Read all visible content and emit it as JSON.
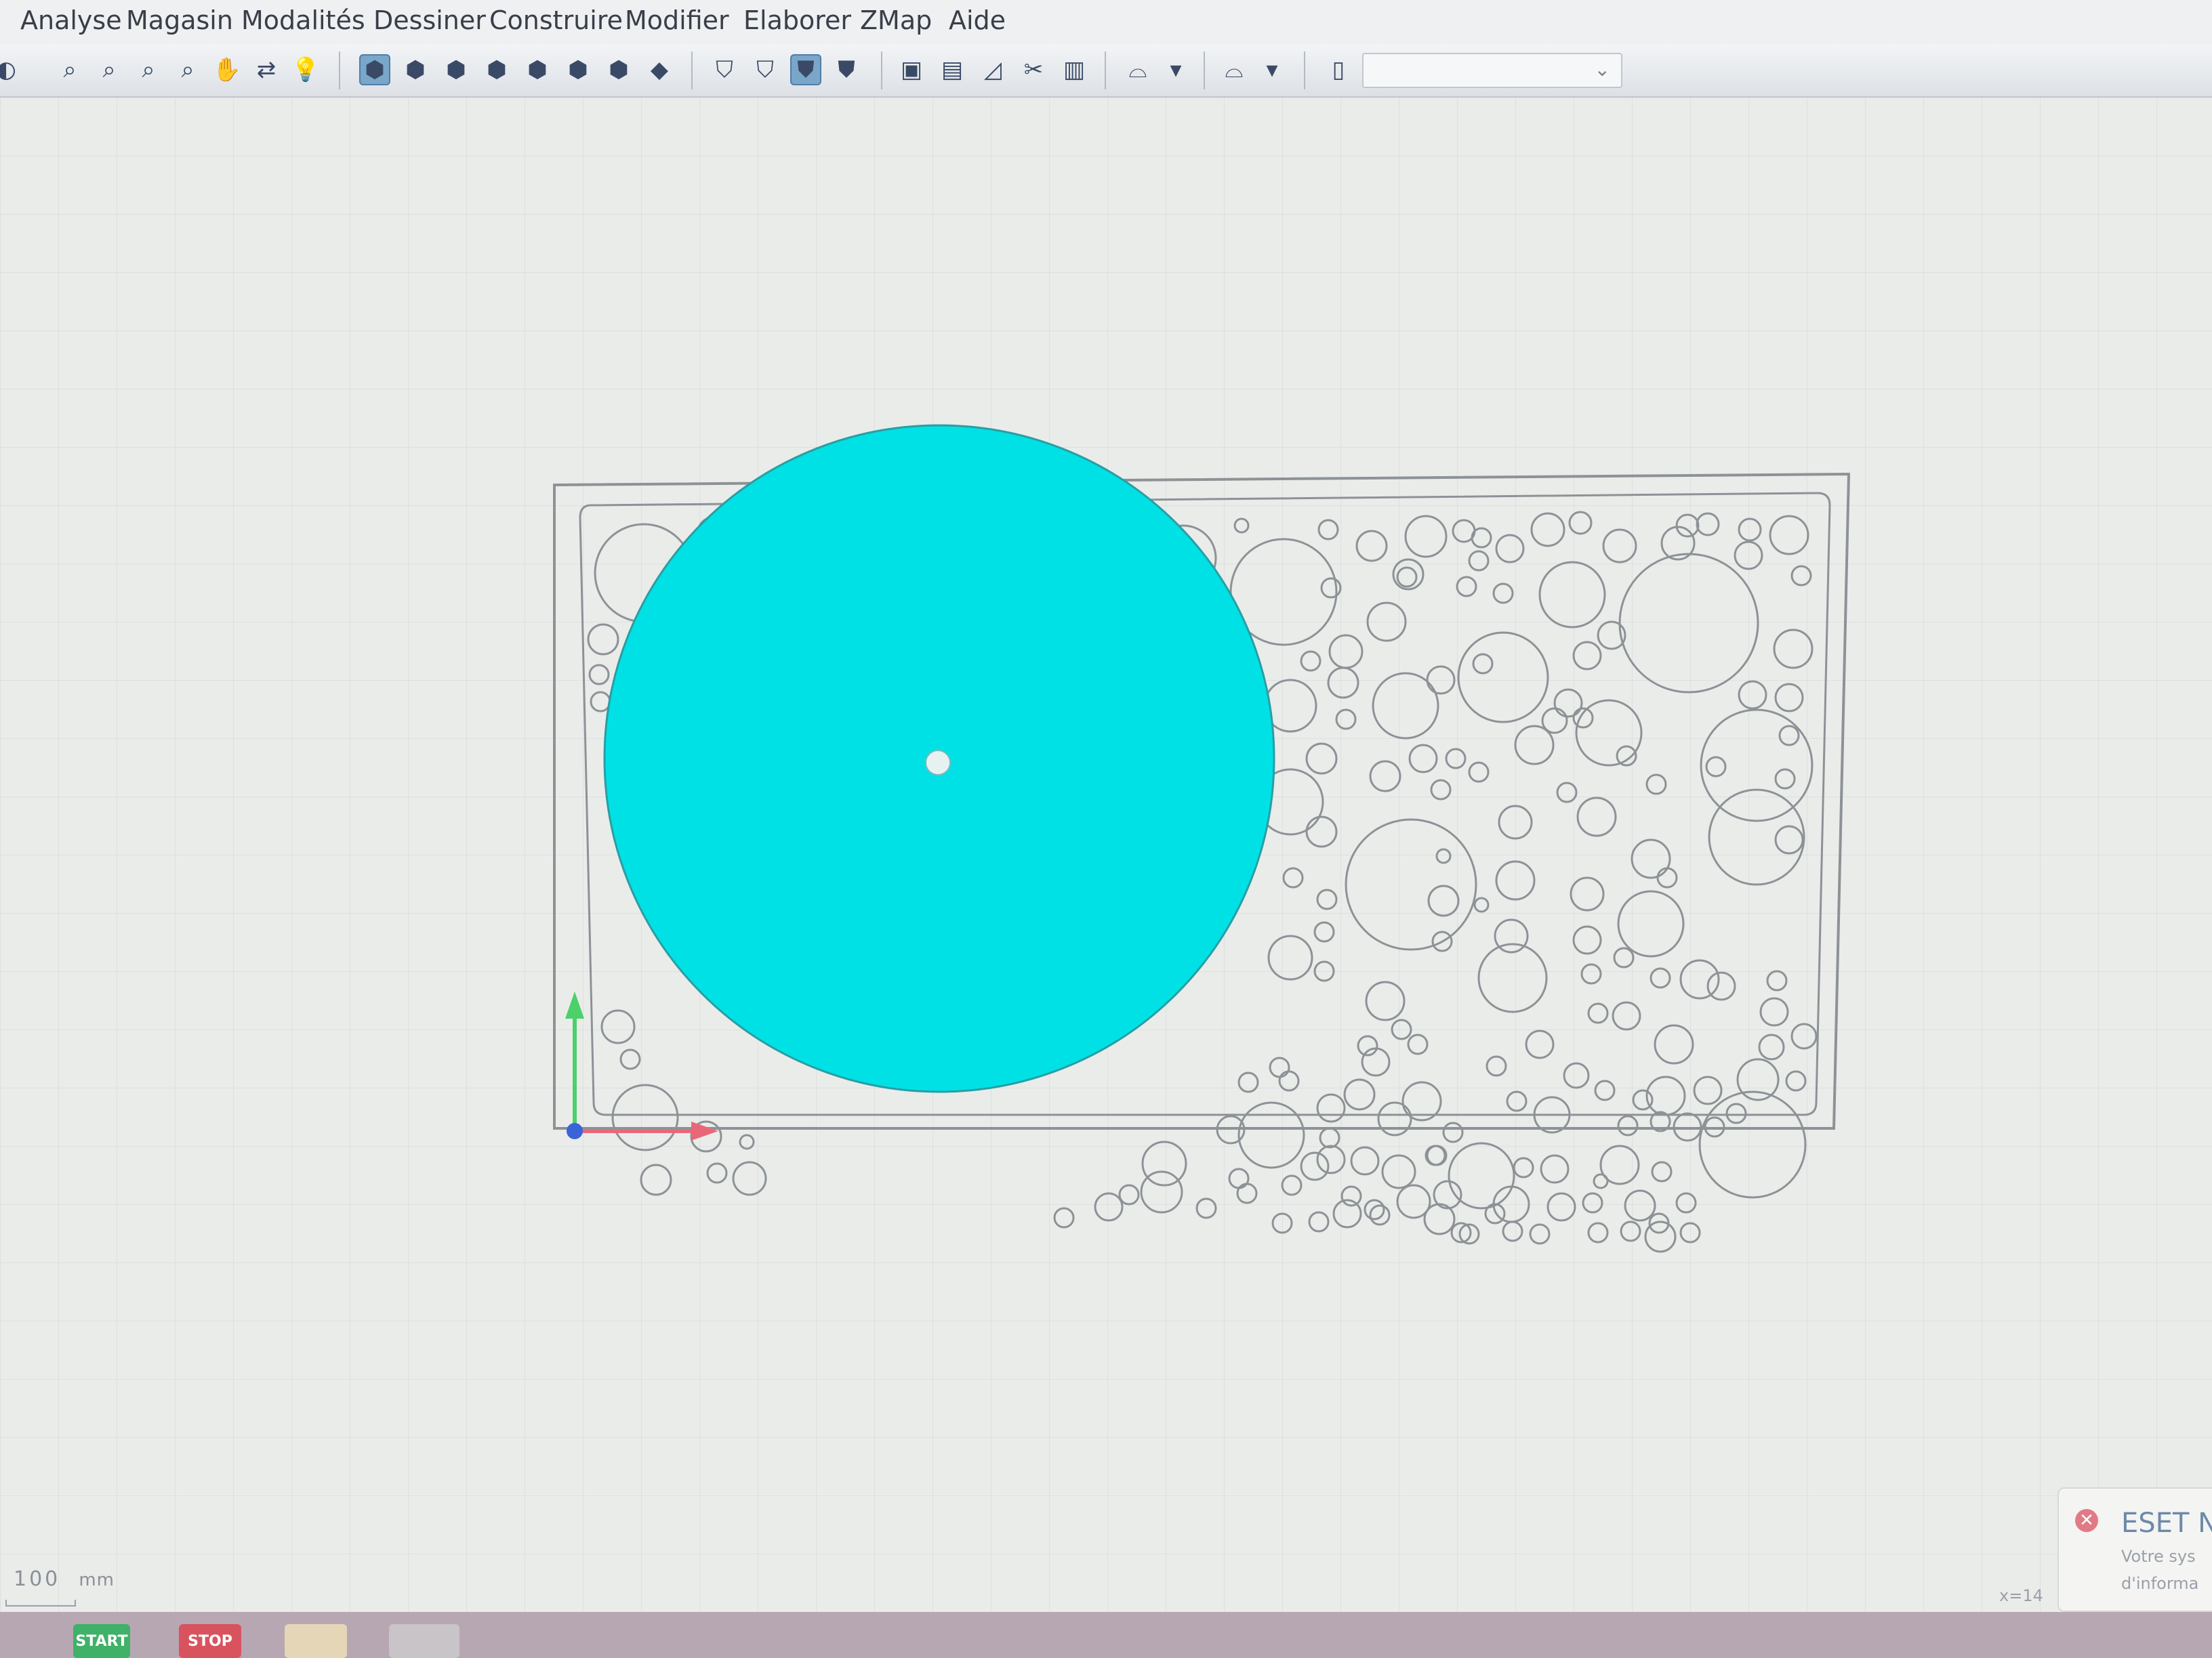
{
  "menu": [
    "Analyse",
    "Magasin",
    "Modalités",
    "Dessiner",
    "Construire",
    "Modifier",
    "Elaborer",
    "ZMap",
    "Aide"
  ],
  "toolbar": {
    "groups": [
      [
        "zoom-in-icon",
        "zoom-window-icon",
        "zoom-out-icon",
        "zoom-previous-icon",
        "pan-hand-icon",
        "orbit-icon",
        "light-bulb-icon"
      ],
      [
        "view-top-icon",
        "view-iso-icon",
        "view-front-icon",
        "view-back-icon",
        "view-right-icon",
        "view-left-icon",
        "view-bottom-icon",
        "view-rotate-icon"
      ],
      [
        "wireframe-icon",
        "hidden-line-icon",
        "shaded-icon",
        "shaded-edges-icon"
      ],
      [
        "select-window-icon",
        "camera-icon",
        "draw-plane-icon",
        "cut-icon",
        "level-icon"
      ],
      [
        "arc-tool-icon",
        "arc-dropdown-icon",
        "curve-tool-icon",
        "curve-dropdown-icon"
      ],
      [
        "document-icon"
      ]
    ],
    "combo_value": ""
  },
  "scale": {
    "value": "100",
    "unit": "mm"
  },
  "notification": {
    "title": "ESET N",
    "line1": "Votre sys",
    "line2": "d'informa"
  },
  "status_coord": "x=14",
  "taskbar": {
    "start_label": "START",
    "stop_label": "STOP"
  },
  "colors": {
    "highlight": "#00e1e5",
    "axis_y": "#4cd06a",
    "axis_x": "#e8687a",
    "origin": "#3b63d8",
    "outline": "#8c9296"
  }
}
